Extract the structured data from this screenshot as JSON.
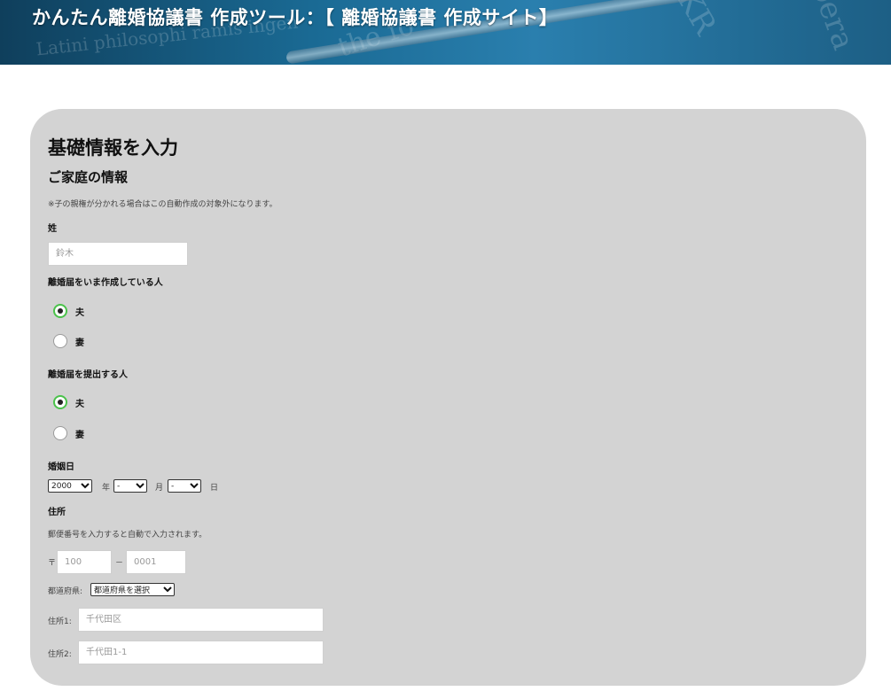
{
  "header": {
    "title": "かんたん離婚協議書 作成ツール：【 離婚協議書 作成サイト】"
  },
  "form": {
    "heading": "基礎情報を入力",
    "section_title": "ご家庭の情報",
    "note": "※子の親権が分かれる場合はこの自動作成の対象外になります。",
    "surname": {
      "label": "姓",
      "placeholder": "鈴木"
    },
    "creator": {
      "label": "離婚届をいま作成している人",
      "options": [
        {
          "label": "夫",
          "checked": true
        },
        {
          "label": "妻",
          "checked": false
        }
      ]
    },
    "submitter": {
      "label": "離婚届を提出する人",
      "options": [
        {
          "label": "夫",
          "checked": true
        },
        {
          "label": "妻",
          "checked": false
        }
      ]
    },
    "marriage_date": {
      "label": "婚姻日",
      "year_value": "2000",
      "year_unit": "年",
      "month_value": "-",
      "month_unit": "月",
      "day_value": "-",
      "day_unit": "日"
    },
    "address": {
      "label": "住所",
      "hint": "郵便番号を入力すると自動で入力されます。",
      "postal_mark": "〒",
      "postal1_placeholder": "100",
      "postal_separator": "－",
      "postal2_placeholder": "0001",
      "prefecture_label": "都道府県:",
      "prefecture_value": "都道府県を選択",
      "address1_label": "住所1:",
      "address1_placeholder": "千代田区",
      "address2_label": "住所2:",
      "address2_placeholder": "千代田1-1"
    }
  },
  "colors": {
    "card_bg": "#d3d3d3",
    "radio_checked_border": "#4bc24b",
    "header_blue": "#1a6a94"
  },
  "icons": {
    "select_arrow": "chevron-down-icon"
  }
}
